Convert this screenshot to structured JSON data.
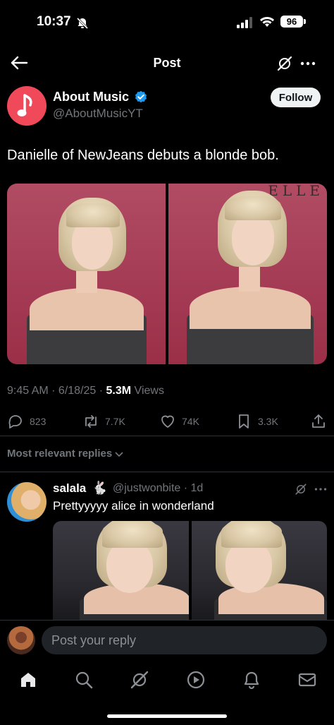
{
  "status_bar": {
    "time": "10:37",
    "battery": "96"
  },
  "nav": {
    "title": "Post"
  },
  "author": {
    "name": "About Music",
    "handle": "@AboutMusicYT",
    "follow_label": "Follow"
  },
  "post": {
    "text": "Danielle of NewJeans debuts a blonde bob.",
    "image_watermark": "ELLE",
    "meta_time": "9:45 AM · 6/18/25 · ",
    "views_count": "5.3M",
    "views_label": " Views"
  },
  "actions": {
    "replies": "823",
    "reposts": "7.7K",
    "likes": "74K",
    "bookmarks": "3.3K"
  },
  "replies_filter": {
    "label": "Most relevant replies"
  },
  "reply": {
    "name": "salala",
    "emoji": "🐇",
    "handle_time": "@justwonbite · 1d",
    "text": "Prettyyyyy alice in wonderland"
  },
  "composer": {
    "placeholder": "Post your reply"
  },
  "colors": {
    "accent": "#1d9bf0",
    "background": "#000000",
    "muted": "#71767b"
  },
  "icons": [
    "back-arrow-icon",
    "grok-icon",
    "more-icon",
    "verified-icon",
    "reply-icon",
    "repost-icon",
    "like-icon",
    "bookmark-icon",
    "share-icon",
    "home-icon",
    "search-icon",
    "notifications-icon",
    "messages-icon",
    "video-icon"
  ]
}
